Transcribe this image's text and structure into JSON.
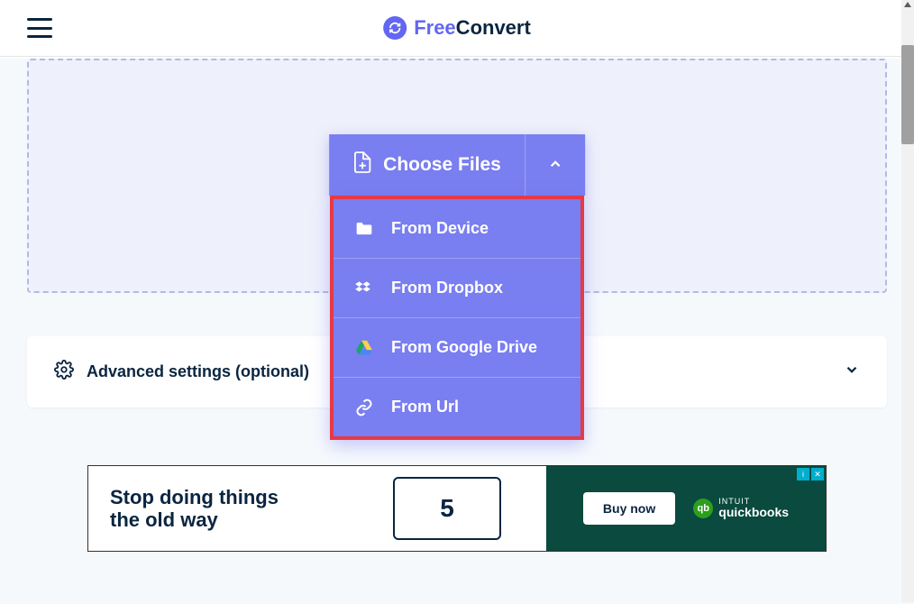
{
  "header": {
    "brand_free": "Free",
    "brand_convert": "Convert"
  },
  "upload": {
    "choose_label": "Choose Files",
    "menu": [
      {
        "label": "From Device",
        "icon": "folder-icon"
      },
      {
        "label": "From Dropbox",
        "icon": "dropbox-icon"
      },
      {
        "label": "From Google Drive",
        "icon": "google-drive-icon"
      },
      {
        "label": "From Url",
        "icon": "link-icon"
      }
    ]
  },
  "advanced": {
    "label": "Advanced settings (optional)"
  },
  "ad": {
    "slogan": "Stop doing things the old way",
    "monitor_number": "5",
    "cta": "Buy now",
    "brand_top": "INTUIT",
    "brand_name": "quickbooks",
    "badge_info": "i",
    "badge_close": "✕"
  }
}
